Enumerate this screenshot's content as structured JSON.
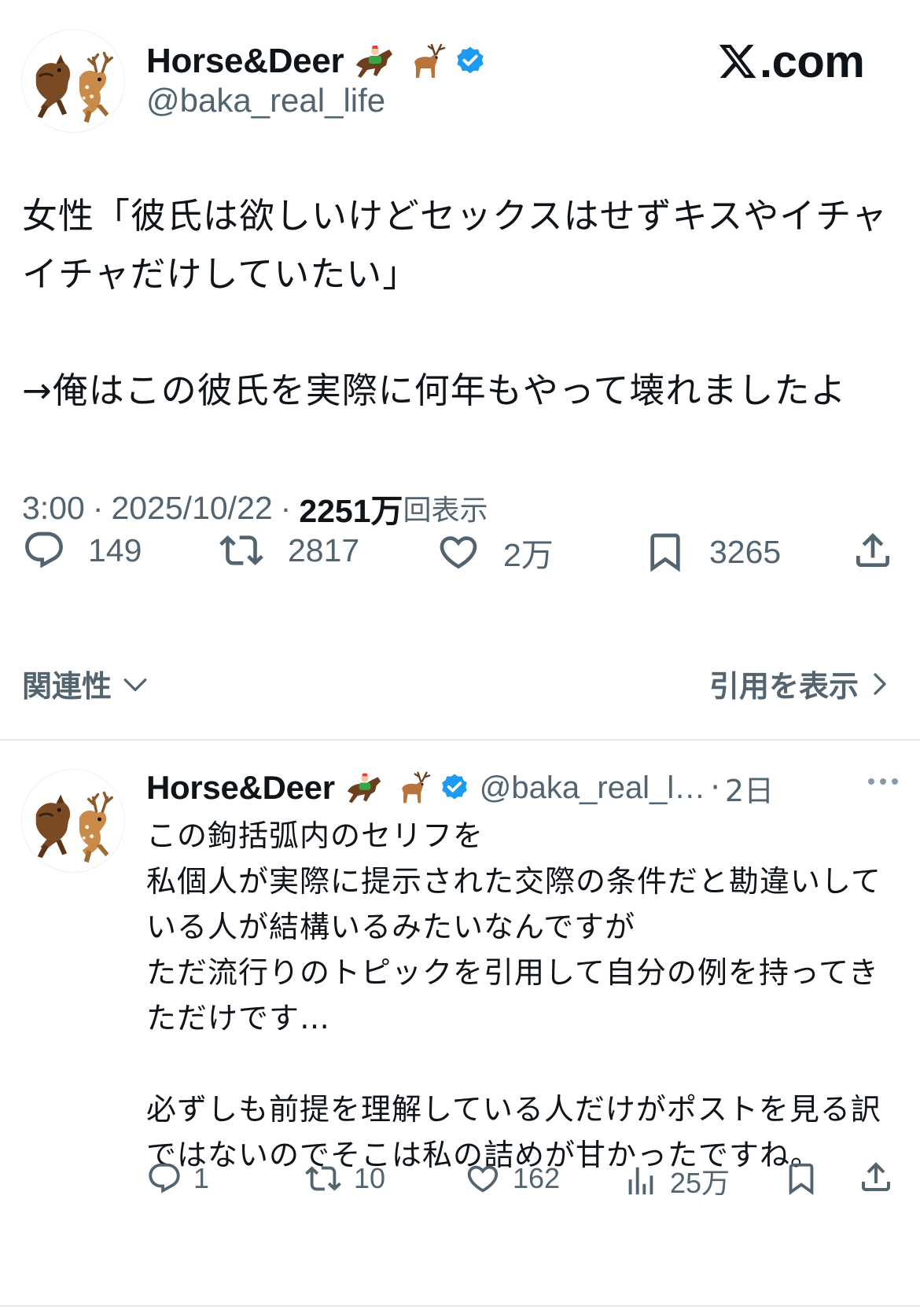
{
  "post": {
    "author": {
      "display_name": "Horse&Deer",
      "handle": "@baka_real_life",
      "name_emojis": [
        "horse-racing-emoji",
        "deer-emoji"
      ],
      "verified_icon": "verified-badge-icon"
    },
    "brand": {
      "logo_icon": "x-logo-icon",
      "suffix": ".com"
    },
    "text_lines": [
      "女性「彼氏は欲しいけどセックスはせずキスやイチャイチャだけしていたい」",
      "",
      "→俺はこの彼氏を実際に何年もやって壊れましたよ"
    ],
    "time": "3:00",
    "date": "2025/10/22",
    "views_count": "2251万",
    "views_label": "回表示",
    "actions": {
      "reply": {
        "icon": "reply-icon",
        "count": "149"
      },
      "repost": {
        "icon": "repost-icon",
        "count": "2817"
      },
      "like": {
        "icon": "heart-icon",
        "count": "2万"
      },
      "bookmark": {
        "icon": "bookmark-icon",
        "count": "3265"
      },
      "share": {
        "icon": "share-icon"
      }
    },
    "sort_label": "関連性",
    "quotes_label": "引用を表示"
  },
  "reply": {
    "author": {
      "display_name": "Horse&Deer",
      "handle": "@baka_real_l…",
      "name_emojis": [
        "horse-racing-emoji",
        "deer-emoji"
      ]
    },
    "separator": "·",
    "time": "2日",
    "text_lines": [
      "この鉤括弧内のセリフを",
      "私個人が実際に提示された交際の条件だと勘違いしている人が結構いるみたいなんですが",
      "ただ流行りのトピックを引用して自分の例を持ってきただけです…",
      "",
      "必ずしも前提を理解している人だけがポストを見る訳ではないのでそこは私の詰めが甘かったですね。"
    ],
    "actions": {
      "reply": {
        "icon": "reply-icon",
        "count": "1"
      },
      "repost": {
        "icon": "repost-icon",
        "count": "10"
      },
      "like": {
        "icon": "heart-icon",
        "count": "162"
      },
      "views": {
        "icon": "analytics-icon",
        "count": "25万"
      },
      "bookmark": {
        "icon": "bookmark-icon"
      },
      "share": {
        "icon": "share-icon"
      }
    }
  },
  "colors": {
    "text_primary": "#0f1419",
    "text_secondary": "#536471",
    "verified_blue": "#1d9bf0",
    "divider": "#e6e9eb"
  }
}
